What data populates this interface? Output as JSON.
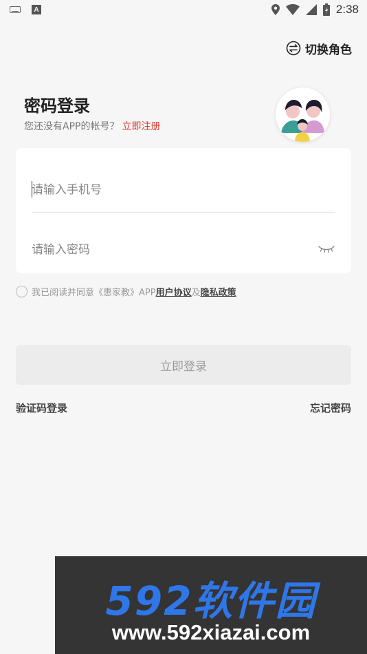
{
  "status_bar": {
    "time": "2:38",
    "left_icons": [
      "keyboard-icon",
      "text-a-icon"
    ],
    "right_icons": [
      "location-icon",
      "wifi-icon",
      "signal-icon",
      "battery-icon"
    ]
  },
  "header": {
    "switch_role_label": "切换角色",
    "switch_role_icon": "swap-icon"
  },
  "login": {
    "title": "密码登录",
    "register_prompt": "您还没有APP的帐号？",
    "register_link": "立即注册",
    "avatar_icon": "family-avatar",
    "phone_placeholder": "请输入手机号",
    "phone_value": "",
    "password_placeholder": "请输入密码",
    "password_value": "",
    "password_toggle_icon": "eye-closed-icon"
  },
  "agreement": {
    "prefix": "我已阅读并同意《惠家教》APP",
    "user_agreement": "用户协议",
    "and": "及",
    "privacy_policy": "隐私政策",
    "checked": false
  },
  "actions": {
    "login_button": "立即登录",
    "sms_login": "验证码登录",
    "forgot_password": "忘记密码"
  },
  "watermark": {
    "title": "592软件园",
    "url": "www.592xiazai.com"
  },
  "colors": {
    "background": "#f6f6f6",
    "accent_red": "#d93a2b",
    "button_disabled": "#ececec",
    "watermark_blue": "#2f76e8"
  }
}
